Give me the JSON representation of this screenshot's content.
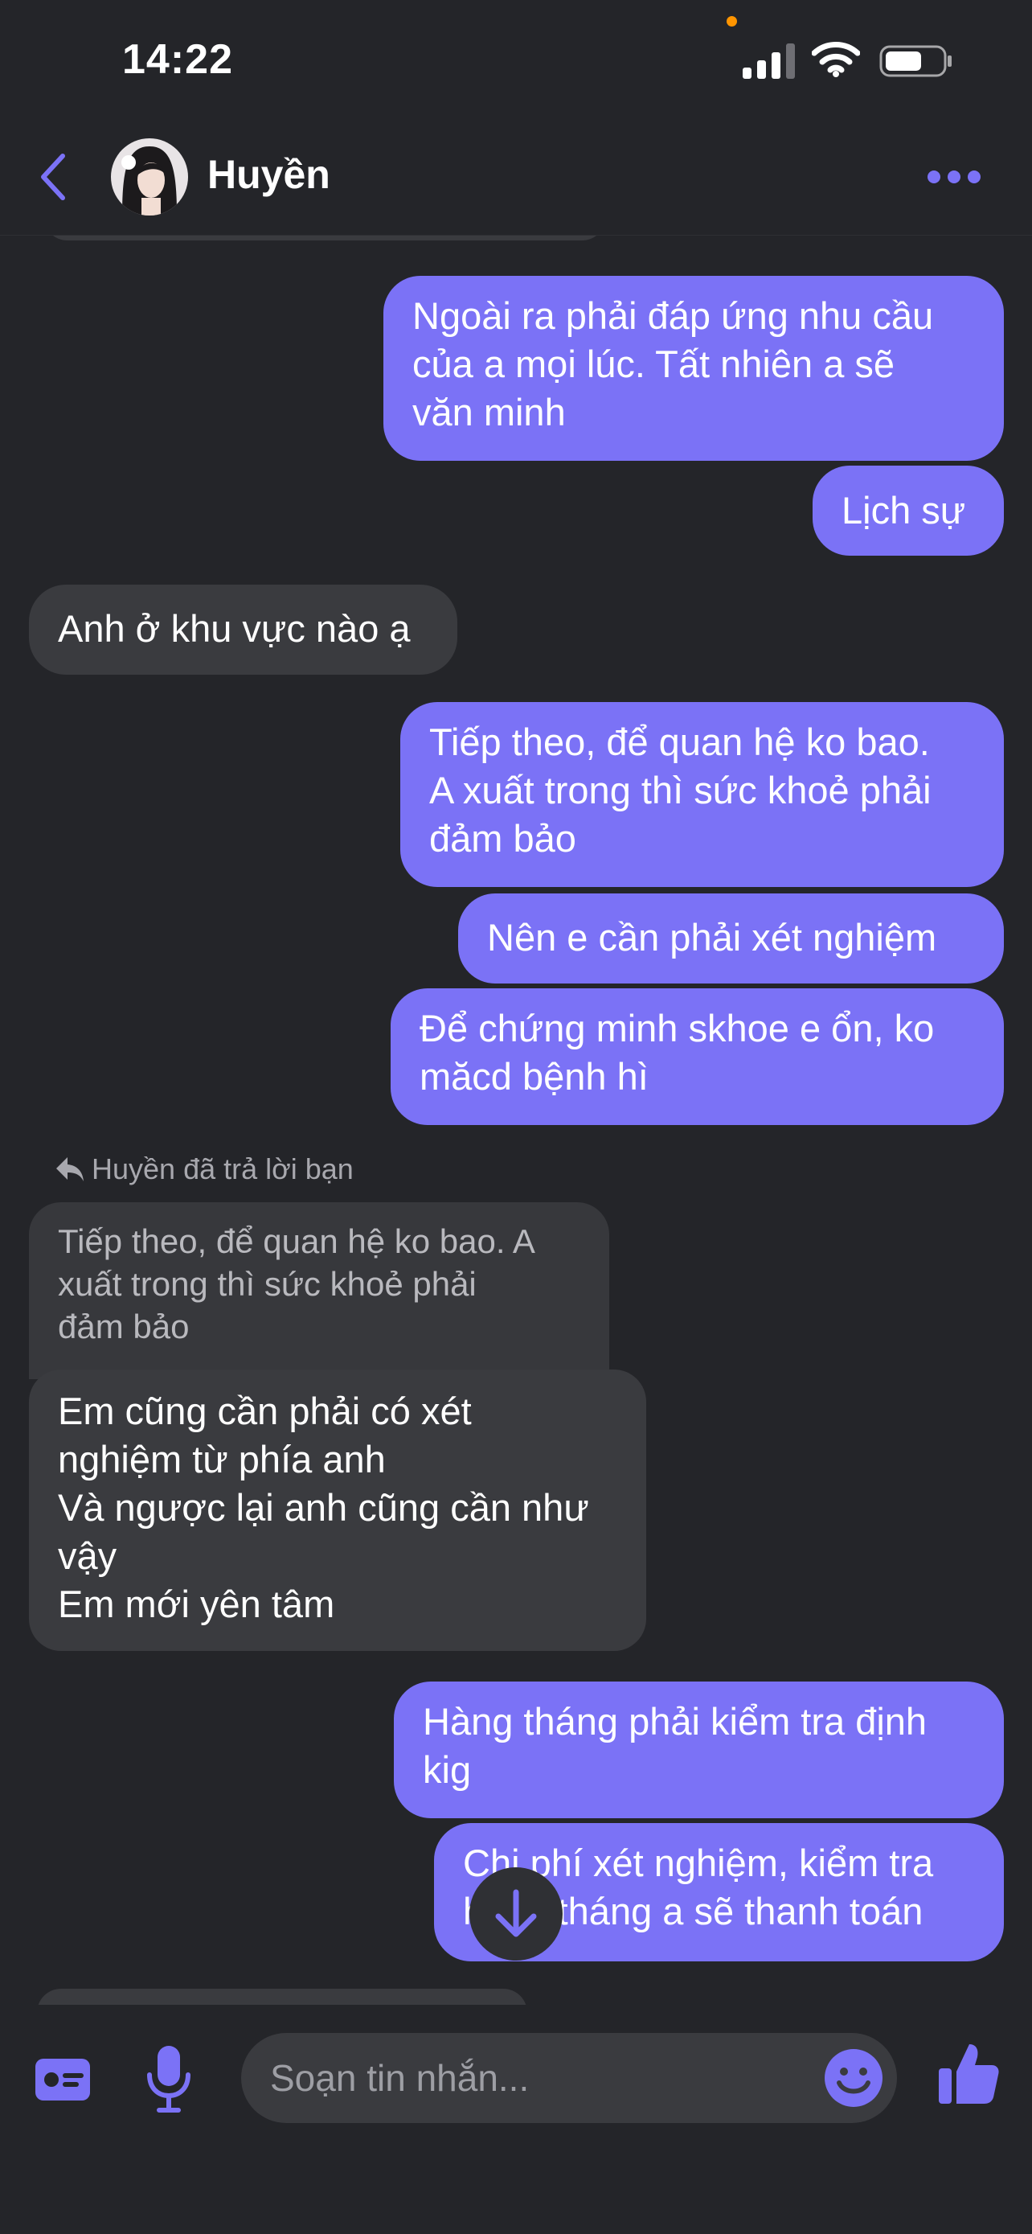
{
  "status_bar": {
    "time": "14:22"
  },
  "header": {
    "contact_name": "Huyền"
  },
  "messages": [
    {
      "direction": "out",
      "text": "Ngoài ra phải đáp ứng nhu cầu\ncủa a mọi lúc. Tất nhiên a sẽ\nvăn minh"
    },
    {
      "direction": "out",
      "text": "Lịch sự"
    },
    {
      "direction": "in",
      "text": "Anh ở khu vực nào ạ"
    },
    {
      "direction": "out",
      "text": "Tiếp theo, để quan hệ ko bao.\nA xuất trong thì sức khoẻ phải\nđảm bảo"
    },
    {
      "direction": "out",
      "text": "Nên e cần phải xét nghiệm"
    },
    {
      "direction": "out",
      "text": "Để chứng minh skhoe e ổn, ko\nmăcd bệnh hì"
    },
    {
      "direction": "in",
      "reply_label": "Huyền đã trả lời bạn",
      "quoted_text": "Tiếp theo, để quan hệ ko bao. A\nxuất trong thì sức khoẻ phải\nđảm bảo",
      "text": "Em cũng cần phải có xét\nnghiệm từ phía anh\nVà ngược lại anh cũng cần như\nvậy\nEm mới yên tâm"
    },
    {
      "direction": "out",
      "text": "Hàng tháng phải kiểm tra định\nkig"
    },
    {
      "direction": "out",
      "text": "Chi phí xét nghiệm, kiểm tra\nhàng tháng a sẽ thanh toán"
    }
  ],
  "composer": {
    "placeholder": "Soạn tin nhắn..."
  },
  "colors": {
    "accent": "#7b72f6",
    "background": "#242529",
    "incoming_bubble": "#3a3b3f"
  }
}
